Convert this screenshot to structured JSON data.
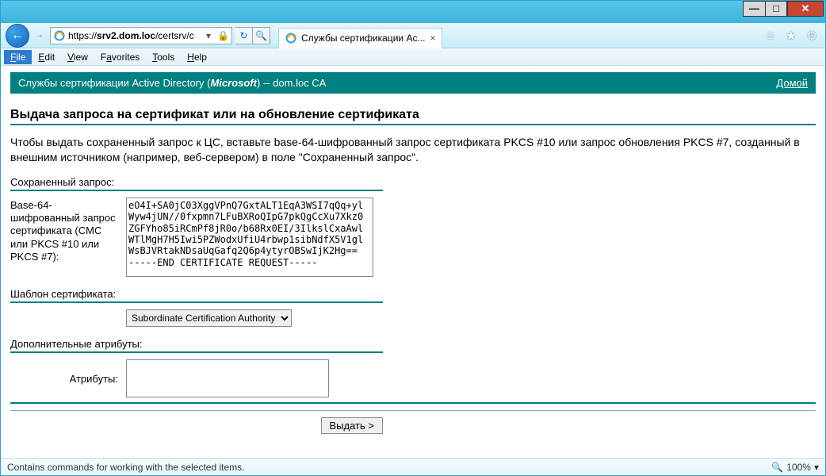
{
  "titlebar": {
    "min": "—",
    "max": "□",
    "close": "✕"
  },
  "toolbar": {
    "back": "←",
    "fwd": "→",
    "dropdown": "▾",
    "url": "https://srv2.dom.loc/certsrv/c",
    "refresh": "↻",
    "stop": "✕",
    "search_icon": "🔍",
    "tab_title": "Службы сертификации Ac...",
    "home_icon": "⌂",
    "star_icon": "★",
    "gear_icon": "⚙"
  },
  "menu": {
    "file": "File",
    "edit": "Edit",
    "view": "View",
    "favorites": "Favorites",
    "tools": "Tools",
    "help": "Help"
  },
  "header_band": {
    "prefix": "Службы сертификации Active Directory (",
    "brand": "Microsoft",
    "suffix": ")  --  dom.loc CA",
    "home_link": "Домой"
  },
  "page": {
    "h1": "Выдача запроса на сертификат или на обновление сертификата",
    "intro": "Чтобы выдать сохраненный запрос к ЦС, вставьте base-64-шифрованный запрос сертификата PKCS #10 или запрос обновления PKCS #7, созданный в внешним источником (например, веб-сервером) в поле \"Сохраненный запрос\"."
  },
  "saved_request": {
    "section": "Сохраненный запрос:",
    "label": "Base-64-шифрованный запрос сертификата (CMC или PKCS #10 или PKCS #7):",
    "value": "eO4I+SA0jC03XggVPnQ7GxtALT1EqA3WSI7qQq+yl\nWyw4jUN//0fxpmn7LFuBXRoQIpG7pkQgCcXu7Xkz0\nZGFYho85iRCmPf8jR0o/b68Rx0EI/3IlkslCxaAwl\nWTlMgH7H5Iwi5PZWodxUfiU4rbwp1sibNdfX5V1gl\nWsBJVRtakNDsaUqGafq2Q6p4ytyrOBSwIjK2Hg==\n-----END CERTIFICATE REQUEST-----"
  },
  "template": {
    "section": "Шаблон сертификата:",
    "options": [
      "Subordinate Certification Authority"
    ]
  },
  "attrs": {
    "section": "Дополнительные атрибуты:",
    "label": "Атрибуты:",
    "value": ""
  },
  "submit": {
    "label": "Выдать >"
  },
  "statusbar": {
    "text": "Contains commands for working with the selected items.",
    "zoom": "100%"
  }
}
